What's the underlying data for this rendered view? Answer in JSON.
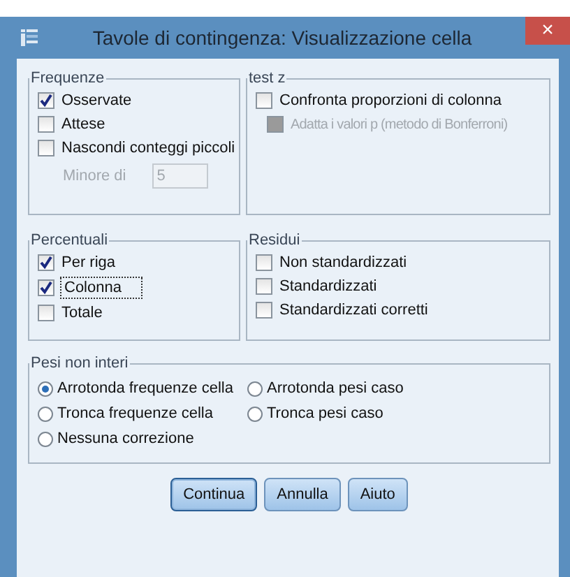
{
  "window": {
    "title": "Tavole di contingenza: Visualizzazione cella",
    "close": "×"
  },
  "groups": [
    {
      "title": "Frequenze",
      "items": [
        {
          "kind": "checkbox",
          "label": "Osservate",
          "checked": true,
          "disabled": false,
          "focused": false
        },
        {
          "kind": "checkbox",
          "label": "Attese",
          "checked": false,
          "disabled": false,
          "focused": false
        },
        {
          "kind": "checkbox",
          "label": "Nascondi conteggi piccoli",
          "checked": false,
          "disabled": false,
          "focused": false
        },
        {
          "kind": "field",
          "label": "Minore di",
          "value": "5",
          "disabled": true
        }
      ]
    },
    {
      "title": "test z",
      "items": [
        {
          "kind": "checkbox",
          "label": "Confronta proporzioni di colonna",
          "checked": false,
          "disabled": false,
          "focused": false
        },
        {
          "kind": "checkbox",
          "label": "Adatta i valori p (metodo di Bonferroni)",
          "checked": false,
          "disabled": true,
          "focused": false,
          "indent": true
        }
      ]
    },
    {
      "title": "Percentuali",
      "items": [
        {
          "kind": "checkbox",
          "label": "Per riga",
          "checked": true,
          "disabled": false,
          "focused": false
        },
        {
          "kind": "checkbox",
          "label": "Colonna",
          "checked": true,
          "disabled": false,
          "focused": true
        },
        {
          "kind": "checkbox",
          "label": "Totale",
          "checked": false,
          "disabled": false,
          "focused": false
        }
      ]
    },
    {
      "title": "Residui",
      "items": [
        {
          "kind": "checkbox",
          "label": "Non standardizzati",
          "checked": false,
          "disabled": false,
          "focused": false
        },
        {
          "kind": "checkbox",
          "label": "Standardizzati",
          "checked": false,
          "disabled": false,
          "focused": false
        },
        {
          "kind": "checkbox",
          "label": "Standardizzati corretti",
          "checked": false,
          "disabled": false,
          "focused": false
        }
      ]
    }
  ],
  "weights": {
    "title": "Pesi non interi",
    "options": [
      {
        "label": "Arrotonda frequenze cella",
        "selected": true
      },
      {
        "label": "Arrotonda pesi caso",
        "selected": false
      },
      {
        "label": "Tronca frequenze cella",
        "selected": false
      },
      {
        "label": "Tronca pesi caso",
        "selected": false
      },
      {
        "label": "Nessuna correzione",
        "selected": false
      }
    ]
  },
  "buttons": [
    {
      "label": "Continua",
      "default": true
    },
    {
      "label": "Annulla",
      "default": false
    },
    {
      "label": "Aiuto",
      "default": false
    }
  ]
}
